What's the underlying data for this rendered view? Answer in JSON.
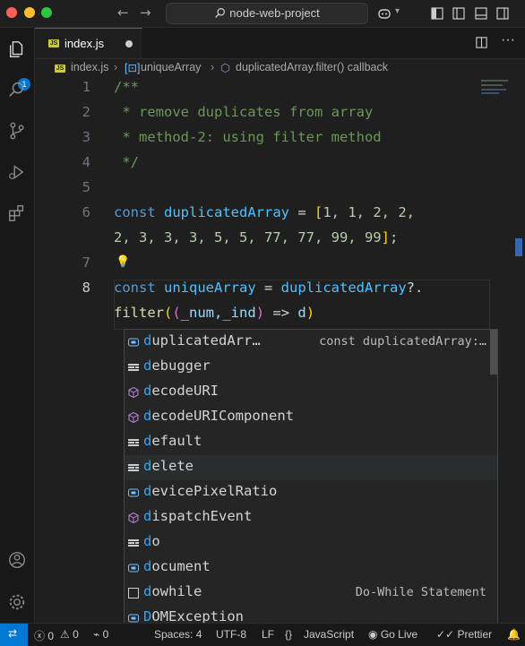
{
  "colors": {
    "accent": "#0078d4",
    "keyword": "#569cd6",
    "variable": "#4fc1ff",
    "number": "#b5cea8",
    "comment": "#6a9955",
    "function": "#dcdcaa",
    "match": "#2aaaff"
  },
  "titlebar": {
    "search_text": "node-web-project",
    "nav_back_icon": "arrow-left-icon",
    "nav_forward_icon": "arrow-right-icon"
  },
  "activity_bar": {
    "explorer_badge": "1"
  },
  "tab": {
    "label": "index.js",
    "icon": "JS"
  },
  "breadcrumb": {
    "file": "index.js",
    "symbol": "uniqueArray",
    "callback": "duplicatedArray.filter() callback"
  },
  "editor": {
    "line_numbers": [
      "1",
      "2",
      "3",
      "4",
      "5",
      "6",
      "7",
      "8"
    ],
    "code": {
      "l1": "/**",
      "l2": " * remove duplicates from array",
      "l3": " * method-2: using filter method",
      "l4": " */",
      "l6_kw": "const",
      "l6_var": "duplicatedArray",
      "l6_eq": " = ",
      "l6_open": "[",
      "l6_nums": "1, 1, 2, 2,",
      "l6b_nums": "2, 3, 3, 3, 5, 5, 77, 77, 99, 99",
      "l6b_close": "]",
      "l6b_semi": ";",
      "l8_kw": "const",
      "l8_var": "uniqueArray",
      "l8_eq": " = ",
      "l8_src": "duplicatedArray",
      "l8_opt": "?.",
      "l9_fn": "filter",
      "l9_open": "(",
      "l9_params_open": "(",
      "l9_params": "_num,_ind",
      "l9_params_close": ")",
      "l9_arrow": " => ",
      "l9_typed": "d",
      "l9_close": ")"
    }
  },
  "suggestions": [
    {
      "match": "d",
      "rest": "uplicatedArr…",
      "detail": "const duplicatedArray:…",
      "icon": "variable-icon"
    },
    {
      "match": "d",
      "rest": "ebugger",
      "detail": "",
      "icon": "keyword-icon"
    },
    {
      "match": "d",
      "rest": "ecodeURI",
      "detail": "",
      "icon": "method-icon"
    },
    {
      "match": "d",
      "rest": "ecodeURIComponent",
      "detail": "",
      "icon": "method-icon"
    },
    {
      "match": "d",
      "rest": "efault",
      "detail": "",
      "icon": "keyword-icon"
    },
    {
      "match": "d",
      "rest": "elete",
      "detail": "",
      "icon": "keyword-icon"
    },
    {
      "match": "d",
      "rest": "evicePixelRatio",
      "detail": "",
      "icon": "variable-icon"
    },
    {
      "match": "d",
      "rest": "ispatchEvent",
      "detail": "",
      "icon": "method-icon"
    },
    {
      "match": "d",
      "rest": "o",
      "detail": "",
      "icon": "keyword-icon"
    },
    {
      "match": "d",
      "rest": "ocument",
      "detail": "",
      "icon": "variable-icon"
    },
    {
      "match": "d",
      "rest": "owhile",
      "detail": "Do-While Statement",
      "icon": "snippet-icon"
    },
    {
      "match": "D",
      "rest": "OMException",
      "detail": "",
      "icon": "variable-icon"
    }
  ],
  "statusbar": {
    "errors": "0",
    "warnings": "0",
    "ports": "0",
    "spaces": "Spaces: 4",
    "encoding": "UTF-8",
    "eol": "LF",
    "braces": "{}",
    "language": "JavaScript",
    "golive": "Go Live",
    "prettier": "Prettier"
  }
}
